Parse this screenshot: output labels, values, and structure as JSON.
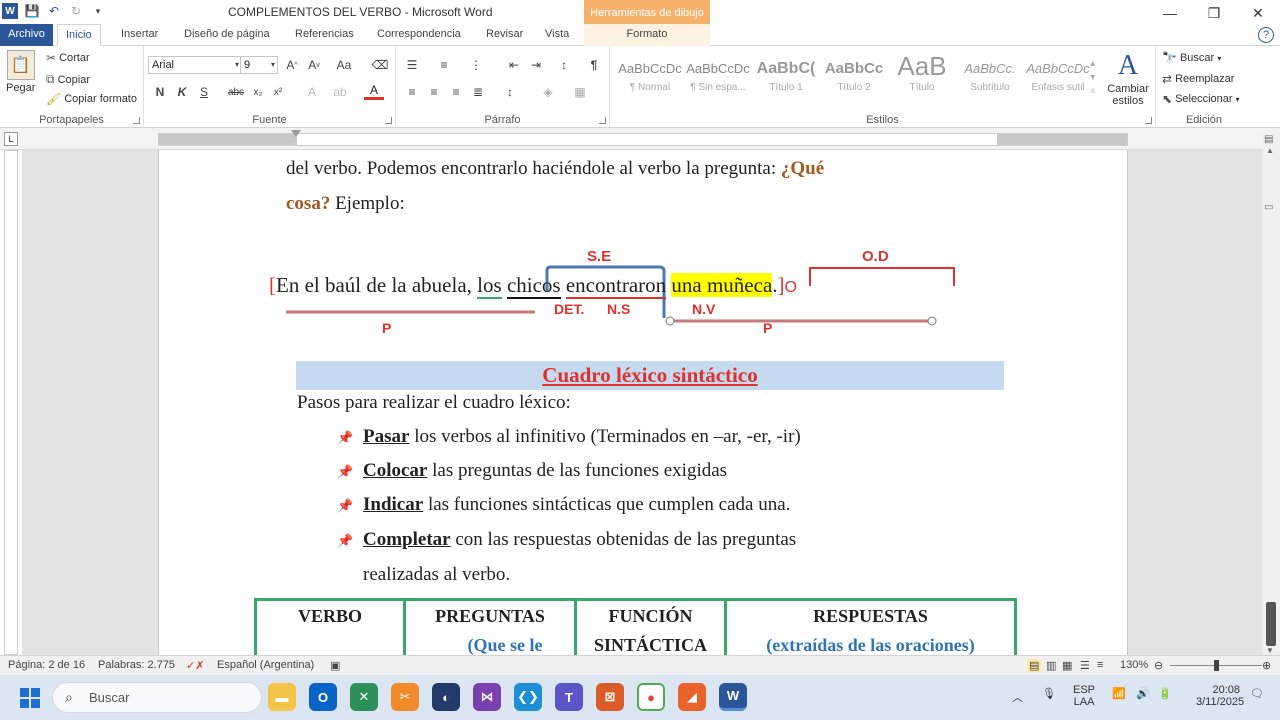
{
  "window": {
    "title": "COMPLEMENTOS DEL VERBO  -  Microsoft Word",
    "context_group": "Herramientas de dibujo"
  },
  "tabs": {
    "file": "Archivo",
    "items": [
      "Inicio",
      "Insertar",
      "Diseño de página",
      "Referencias",
      "Correspondencia",
      "Revisar",
      "Vista",
      "Formato"
    ],
    "active": "Inicio"
  },
  "ribbon": {
    "clipboard": {
      "label": "Portapapeles",
      "paste": "Pegar",
      "cut": "Cortar",
      "copy": "Copiar",
      "format_painter": "Copiar formato"
    },
    "font": {
      "label": "Fuente",
      "font_name": "Arial",
      "font_size": "9"
    },
    "paragraph": {
      "label": "Párrafo"
    },
    "styles": {
      "label": "Estilos",
      "items": [
        {
          "preview": "AaBbCcDc",
          "name": "¶ Normal"
        },
        {
          "preview": "AaBbCcDc",
          "name": "¶ Sin espa..."
        },
        {
          "preview": "AaBbC(",
          "name": "Título 1"
        },
        {
          "preview": "AaBbCc",
          "name": "Título 2"
        },
        {
          "preview": "AaB",
          "name": "Título"
        },
        {
          "preview": "AaBbCc.",
          "name": "Subtítulo"
        },
        {
          "preview": "AaBbCcDc",
          "name": "Énfasis sutil"
        }
      ],
      "change": "Cambiar estilos"
    },
    "editing": {
      "label": "Edición",
      "find": "Buscar",
      "replace": "Reemplazar",
      "select": "Seleccionar"
    }
  },
  "document": {
    "line1": "del verbo. Podemos encontrarlo haciéndole al verbo la pregunta:",
    "line1_question": "¿Qué",
    "line2_question": "cosa?",
    "line2_rest": "Ejemplo:",
    "sentence": {
      "open_bracket": "[",
      "part1": "En el baúl de la abuela,",
      "det": "los",
      "noun": "chicos",
      "verb": "encontraron",
      "object": "una muñeca",
      "period": ".",
      "close_bracket": "]",
      "end_marker": "O"
    },
    "labels": {
      "se": "S.E",
      "od": "O.D",
      "det": "DET.",
      "ns": "N.S",
      "nv": "N.V",
      "p1": "P",
      "p2": "P"
    },
    "cuadro_title": "Cuadro léxico sintáctico",
    "steps_intro": "Pasos para realizar el cuadro léxico:",
    "steps": [
      {
        "verb": "Pasar",
        "rest": " los verbos al infinitivo (Terminados en –ar, -er, -ir)"
      },
      {
        "verb": "Colocar",
        "rest": " las preguntas de las funciones exigidas"
      },
      {
        "verb": "Indicar",
        "rest": " las funciones sintácticas que cumplen cada una."
      },
      {
        "verb": "Completar",
        "rest": " con las respuestas obtenidas de las preguntas"
      }
    ],
    "steps_continuation": "realizadas al verbo.",
    "table_headers": [
      {
        "l1": "VERBO",
        "l2": ""
      },
      {
        "l1": "PREGUNTAS",
        "l2": "(Que se le"
      },
      {
        "l1": "FUNCIÓN",
        "l2": "SINTÁCTICA"
      },
      {
        "l1": "RESPUESTAS",
        "l2": "(extraídas de las oraciones)"
      }
    ]
  },
  "statusbar": {
    "page": "Página: 2 de 16",
    "words": "Palabras: 2.775",
    "language": "Español (Argentina)",
    "zoom": "130%"
  },
  "taskbar": {
    "search_placeholder": "Buscar",
    "lang1": "ESP",
    "lang2": "LAA",
    "time": "20:08",
    "date": "3/11/2025"
  },
  "colors": {
    "accent": "#2b579a",
    "red": "#e0312b",
    "green": "#36a66b",
    "blue_text": "#2e75b6",
    "highlight": "#ffff00"
  }
}
